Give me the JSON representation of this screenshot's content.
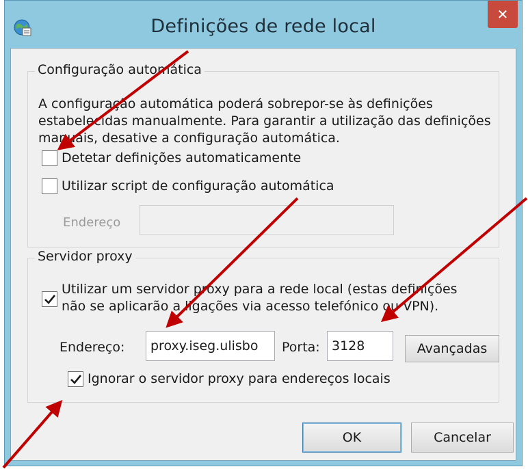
{
  "window": {
    "title": "Definições de rede local",
    "close_glyph": "✕"
  },
  "auto_config": {
    "legend": "Configuração automática",
    "description": "A configuração automática poderá sobrepor-se às definições estabelecidas manualmente. Para garantir a utilização das definições manuais, desative a configuração automática.",
    "detect_label": "Detetar definições automaticamente",
    "detect_checked": false,
    "script_label": "Utilizar script de configuração automática",
    "script_checked": false,
    "address_label": "Endereço",
    "address_value": ""
  },
  "proxy": {
    "legend": "Servidor proxy",
    "use_proxy_label": "Utilizar um servidor proxy para a rede local (estas definições não se aplicarão a ligações via acesso telefónico ou VPN).",
    "use_proxy_checked": true,
    "address_label": "Endereço:",
    "address_value": "proxy.iseg.ulisbo",
    "port_label": "Porta:",
    "port_value": "3128",
    "advanced_label": "Avançadas",
    "bypass_label": "Ignorar o servidor proxy para endereços locais",
    "bypass_checked": true
  },
  "buttons": {
    "ok": "OK",
    "cancel": "Cancelar"
  },
  "colors": {
    "annotation_arrow": "#c00000",
    "close_button": "#c74a3c",
    "title_frame": "#8fc9e0"
  }
}
